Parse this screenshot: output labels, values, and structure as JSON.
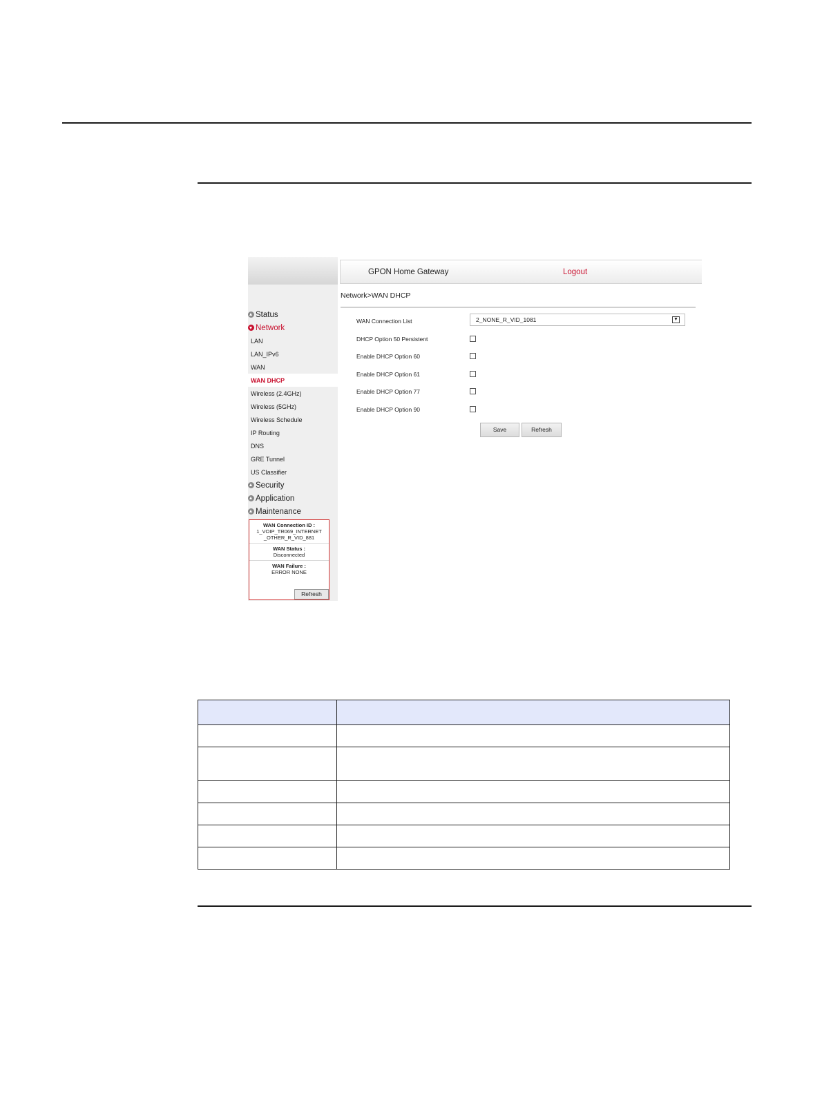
{
  "ui": {
    "title": "GPON Home Gateway",
    "logout": "Logout",
    "breadcrumb": "Network>WAN DHCP",
    "menu": [
      {
        "label": "Status",
        "type": "top"
      },
      {
        "label": "Network",
        "type": "top",
        "active": true
      },
      {
        "label": "LAN",
        "type": "sub"
      },
      {
        "label": "LAN_IPv6",
        "type": "sub"
      },
      {
        "label": "WAN",
        "type": "sub"
      },
      {
        "label": "WAN DHCP",
        "type": "sub",
        "active": true
      },
      {
        "label": "Wireless (2.4GHz)",
        "type": "sub"
      },
      {
        "label": "Wireless (5GHz)",
        "type": "sub"
      },
      {
        "label": "Wireless Schedule",
        "type": "sub"
      },
      {
        "label": "IP Routing",
        "type": "sub"
      },
      {
        "label": "DNS",
        "type": "sub"
      },
      {
        "label": "GRE Tunnel",
        "type": "sub"
      },
      {
        "label": "US Classifier",
        "type": "sub"
      },
      {
        "label": "Security",
        "type": "top"
      },
      {
        "label": "Application",
        "type": "top"
      },
      {
        "label": "Maintenance",
        "type": "top"
      }
    ],
    "status_box": {
      "conn_id_label": "WAN Connection ID :",
      "conn_id_value": "1_VOIP_TR069_INTERNET _OTHER_R_VID_881",
      "status_label": "WAN Status :",
      "status_value": "Disconnected",
      "failure_label": "WAN Failure :",
      "failure_value": "ERROR NONE",
      "refresh": "Refresh"
    },
    "form": {
      "conn_list_label": "WAN Connection List",
      "conn_list_value": "2_NONE_R_VID_1081",
      "options": [
        "DHCP Option 50 Persistent",
        "Enable DHCP Option 60",
        "Enable DHCP Option 61",
        "Enable DHCP Option 77",
        "Enable DHCP Option 90"
      ],
      "save": "Save",
      "refresh": "Refresh"
    }
  },
  "colors": {
    "accent": "#c8102e",
    "table_header": "#e3e8fb"
  }
}
